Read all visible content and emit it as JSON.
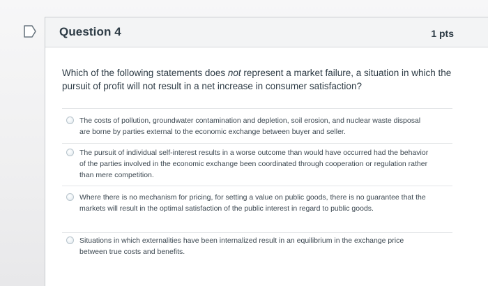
{
  "question": {
    "title": "Question 4",
    "points": "1 pts",
    "prompt_before": "Which of the following statements does ",
    "prompt_emphasis": "not",
    "prompt_after": " represent a market failure, a situation in which the pursuit of profit will not result in a net increase in consumer satisfaction?"
  },
  "answers": [
    {
      "label": "The costs of pollution, groundwater contamination and depletion, soil erosion, and nuclear waste disposal are borne by parties external to the economic exchange between buyer and seller."
    },
    {
      "label": "The pursuit of individual self-interest results in a worse outcome than would have occurred had the behavior of the parties involved in the economic exchange been coordinated through cooperation or regulation rather than mere competition."
    },
    {
      "label": "Where there is no mechanism for pricing, for setting a value on public goods, there is no guarantee that the markets will result in the optimal satisfaction of the public interest in regard to public goods."
    },
    {
      "label": "Situations in which externalities have been internalized result in an equilibrium in the exchange price between true costs and benefits."
    }
  ],
  "colors": {
    "text": "#2d3b45",
    "header_bg": "#f3f4f5",
    "border": "#c9ccd0"
  },
  "icons": {
    "flag": "flag-icon",
    "radio": "radio-button"
  }
}
